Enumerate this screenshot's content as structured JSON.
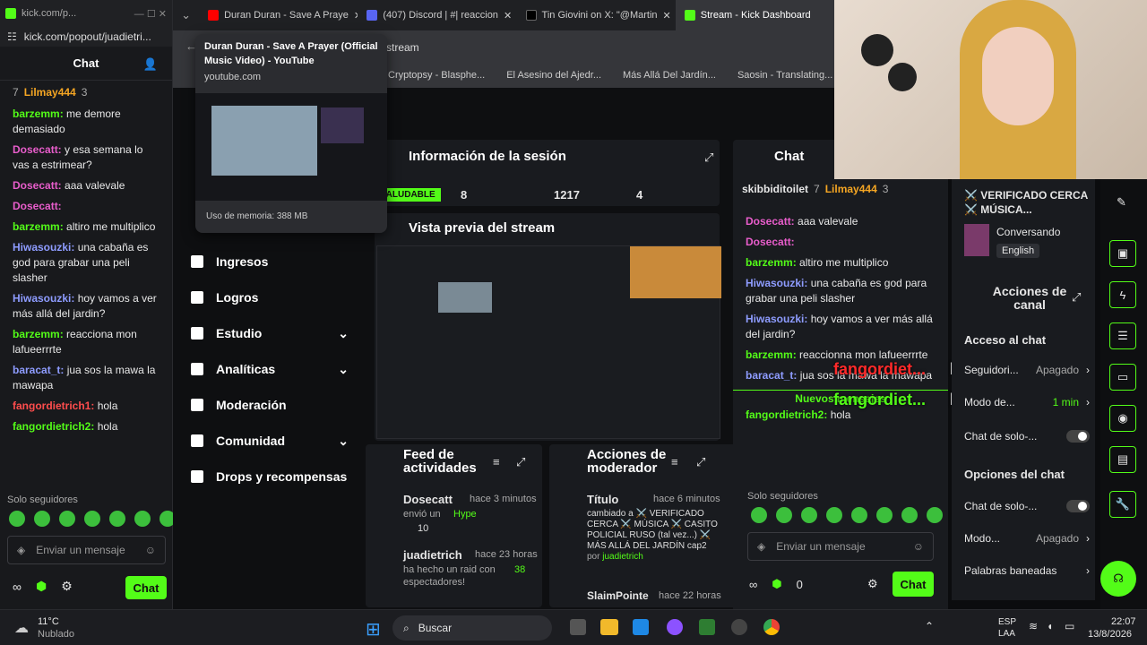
{
  "left_window": {
    "url_short": "kick.com/p...",
    "url": "kick.com/popout/juadietri...",
    "chat_title": "Chat",
    "pinned": {
      "count": "7",
      "user": "Lilmay444",
      "num": "3"
    },
    "messages": [
      {
        "user": "barzemm:",
        "text": "me demore demasiado",
        "color": "u1"
      },
      {
        "user": "Dosecatt:",
        "text": "y esa semana lo vas a estrimear?",
        "color": "u2"
      },
      {
        "user": "Dosecatt:",
        "text": "aaa valevale",
        "color": "u2"
      },
      {
        "user": "Dosecatt:",
        "text": "",
        "color": "u2"
      },
      {
        "user": "barzemm:",
        "text": "altiro me multiplico",
        "color": "u1"
      },
      {
        "user": "Hiwasouzki:",
        "text": "una cabaña es god para grabar una peli slasher",
        "color": "u3"
      },
      {
        "user": "Hiwasouzki:",
        "text": "hoy vamos a ver más allá del jardin?",
        "color": "u3"
      },
      {
        "user": "barzemm:",
        "text": "reacciona mon lafueerrrte",
        "color": "u1"
      },
      {
        "user": "baracat_t:",
        "text": "jua sos la mawa la mawapa",
        "color": "u3"
      },
      {
        "user": "fangordietrich1:",
        "text": "hola",
        "color": "u4"
      },
      {
        "user": "fangordietrich2:",
        "text": "hola",
        "color": "u5"
      }
    ],
    "followers_only": "Solo seguidores",
    "input_placeholder": "Enviar un mensaje",
    "chat_btn": "Chat"
  },
  "tabs": [
    {
      "label": "Duran Duran - Save A Praye",
      "color": "#ff0000"
    },
    {
      "label": "(407) Discord | #| reaccion",
      "color": "#5865f2"
    },
    {
      "label": "Tin Giovini on X: \"@Martin",
      "color": "#000000"
    },
    {
      "label": "Stream - Kick Dashboard",
      "color": "#53fc18",
      "active": true
    }
  ],
  "address_tail": "stream",
  "bookmarks": [
    "Cryptopsy - Blasphe...",
    "El Asesino del Ajedr...",
    "Más Allá Del Jardín...",
    "Saosin - Translating..."
  ],
  "popup": {
    "title": "Duran Duran - Save A Prayer (Official Music Video) - YouTube",
    "site": "youtube.com",
    "memory": "Uso de memoria: 388 MB"
  },
  "sidebar": [
    "Ingresos",
    "Logros",
    "Estudio",
    "Analíticas",
    "Moderación",
    "Comunidad",
    "Drops y recompensas"
  ],
  "session": {
    "title": "Información de la sesión",
    "status": "SALUDABLE",
    "v1": "8",
    "v2": "1217",
    "v3": "4"
  },
  "preview_title": "Vista previa del stream",
  "feed": {
    "title": "Feed de actividades",
    "items": [
      {
        "user": "Dosecatt",
        "time": "hace 3 minutos",
        "action": "envió un",
        "hype": "Hype",
        "amount": "10"
      },
      {
        "user": "juadietrich",
        "time": "hace 23 horas",
        "action": "ha hecho un raid con",
        "num": "38",
        "tail": "espectadores!"
      }
    ]
  },
  "mod": {
    "title": "Acciones de moderador",
    "items": [
      {
        "label": "Título",
        "time": "hace 6 minutos",
        "detail": "cambiado a ⚔️ VERIFICADO CERCA ⚔️ MÚSICA ⚔️ CASITO POLICIAL RUSO (tal vez...) ⚔️ MÁS ALLÁ DEL JARDÍN cap2",
        "by": "por",
        "byuser": "juadietrich"
      },
      {
        "label": "SlaimPointe",
        "time": "hace 22 horas"
      }
    ]
  },
  "dash_chat": {
    "title": "Chat",
    "pinned1": "skibbiditoilet",
    "p1n": "7",
    "pinned2": "Lilmay444",
    "p2n": "3",
    "messages": [
      {
        "user": "Dosecatt:",
        "text": "aaa valevale",
        "color": "u2"
      },
      {
        "user": "Dosecatt:",
        "text": "",
        "color": "u2"
      },
      {
        "user": "barzemm:",
        "text": "altiro me multiplico",
        "color": "u1"
      },
      {
        "user": "Hiwasouzki:",
        "text": "una cabaña es god para grabar una peli slasher",
        "color": "u3"
      },
      {
        "user": "Hiwasouzki:",
        "text": "hoy vamos a ver más allá del jardin?",
        "color": "u3"
      },
      {
        "user": "barzemm:",
        "text": "reaccionna mon lafueerrrte",
        "color": "u1"
      },
      {
        "user": "baracat_t:",
        "text": "jua sos la mawa la mawapa",
        "color": "u3"
      }
    ],
    "new_msgs": "Nuevos mensajes",
    "last_user": "fangordietrich2:",
    "last_text": "hola",
    "followers_only": "Solo seguidores",
    "placeholder": "Enviar un mensaje",
    "count": "0",
    "chat_btn": "Chat"
  },
  "overlay": {
    "a": "fangordiet...",
    "b": "hola",
    "c": "fangordiet...",
    "d": "hola"
  },
  "channel": {
    "stream_title": "⚔️ VERIFICADO CERCA ⚔️ MÚSICA...",
    "category": "Conversando",
    "lang": "English",
    "actions_title": "Acciones de canal",
    "chat_access": "Acceso al chat",
    "r1": "Seguidori...",
    "r1v": "Apagado",
    "r2": "Modo de...",
    "r2v": "1 min",
    "r3": "Chat de solo-...",
    "chat_opts": "Opciones del chat",
    "r4": "Chat de solo-...",
    "r5": "Modo...",
    "r5v": "Apagado",
    "r6": "Palabras baneadas"
  },
  "taskbar": {
    "temp": "11°C",
    "weather": "Nublado",
    "search": "Buscar",
    "lang1": "ESP",
    "lang2": "LAA",
    "time": "22:07",
    "date": "13/8/2026"
  }
}
